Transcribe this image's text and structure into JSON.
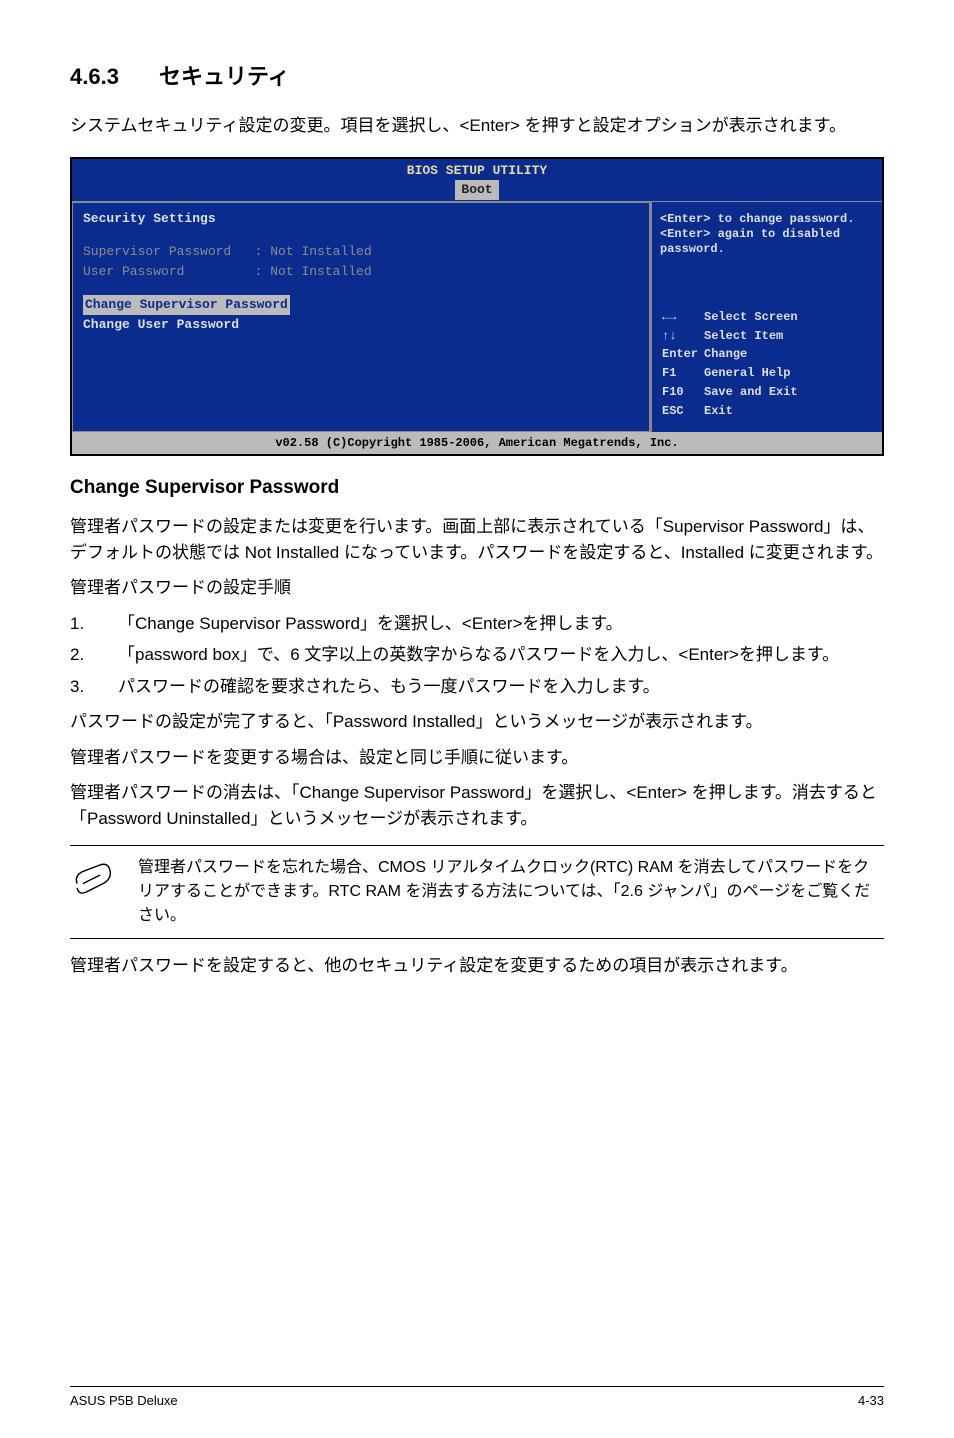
{
  "section": {
    "number": "4.6.3",
    "title": "セキュリティ"
  },
  "intro": "システムセキュリティ設定の変更。項目を選択し、<Enter> を押すと設定オプションが表示されます。",
  "bios": {
    "title": "BIOS SETUP UTILITY",
    "tab": "Boot",
    "heading": "Security Settings",
    "rows": [
      {
        "label": "Supervisor Password",
        "value": ": Not Installed"
      },
      {
        "label": "User Password",
        "value": ": Not Installed"
      }
    ],
    "menu": {
      "selected": "Change Supervisor Password",
      "unselected": "Change User Password"
    },
    "help": [
      "<Enter> to change password.",
      "<Enter> again to disabled password."
    ],
    "keys": [
      {
        "k": "←→",
        "d": "Select Screen"
      },
      {
        "k": "↑↓",
        "d": "Select Item"
      },
      {
        "k": "Enter",
        "d": "Change"
      },
      {
        "k": "F1",
        "d": "General Help"
      },
      {
        "k": "F10",
        "d": "Save and Exit"
      },
      {
        "k": "ESC",
        "d": "Exit"
      }
    ],
    "footer": "v02.58 (C)Copyright 1985-2006, American Megatrends, Inc."
  },
  "subhead": "Change Supervisor Password",
  "para1": "管理者パスワードの設定または変更を行います。画面上部に表示されている「Supervisor Password」は、デフォルトの状態では Not Installed になっています。パスワードを設定すると、Installed に変更されます。",
  "stepsTitle": "管理者パスワードの設定手順",
  "steps": [
    "「Change Supervisor Password」を選択し、<Enter>を押します。",
    "「password box」で、6 文字以上の英数字からなるパスワードを入力し、<Enter>を押します。",
    "パスワードの確認を要求されたら、もう一度パスワードを入力します。"
  ],
  "para2": "パスワードの設定が完了すると、「Password Installed」というメッセージが表示されます。",
  "para3": "管理者パスワードを変更する場合は、設定と同じ手順に従います。",
  "para4": "管理者パスワードの消去は、「Change Supervisor Password」を選択し、<Enter> を押します。消去すると「Password Uninstalled」というメッセージが表示されます。",
  "note": "管理者パスワードを忘れた場合、CMOS リアルタイムクロック(RTC) RAM を消去してパスワードをクリアすることができます。RTC RAM を消去する方法については、「2.6 ジャンパ」のページをご覧ください。",
  "para5": "管理者パスワードを設定すると、他のセキュリティ設定を変更するための項目が表示されます。",
  "footer": {
    "left": "ASUS P5B Deluxe",
    "right": "4-33"
  }
}
